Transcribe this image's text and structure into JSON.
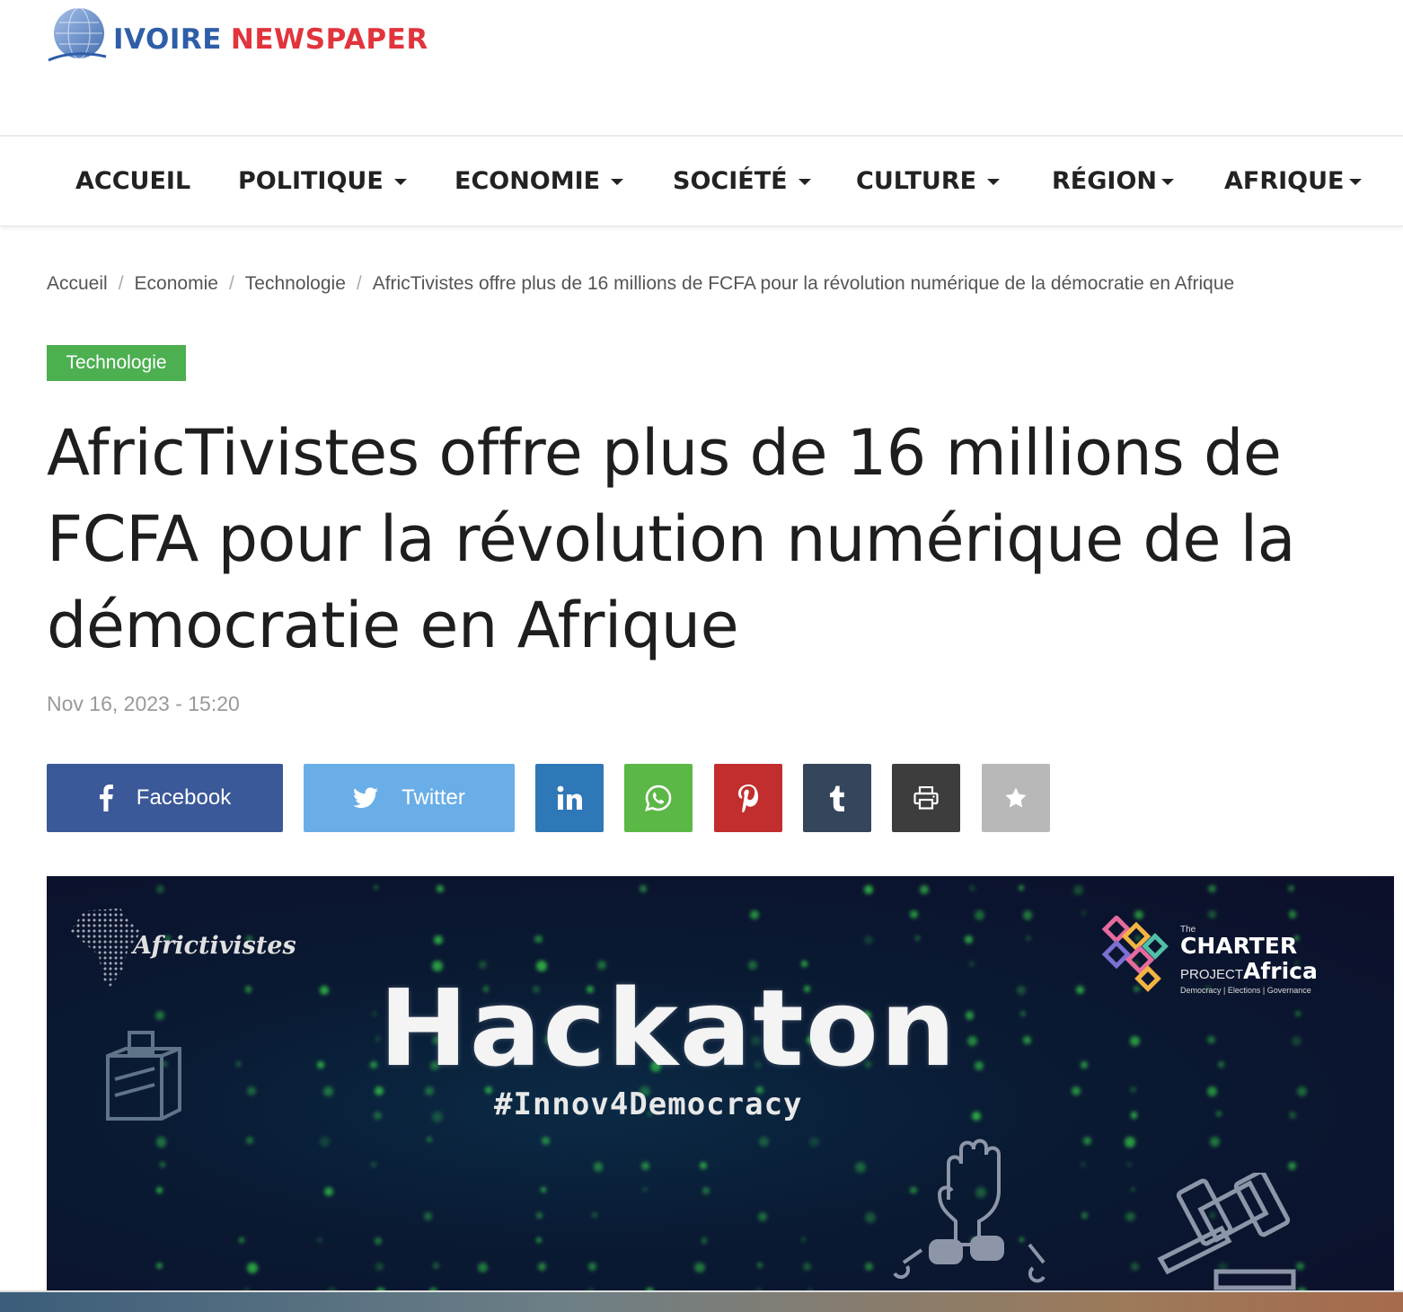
{
  "site": {
    "logo_part1": "IVOIRE",
    "logo_part2": "NEWSPAPER",
    "colors": {
      "logo_blue": "#2f5ea8",
      "logo_red": "#e1343c",
      "category_green": "#4caf50"
    }
  },
  "nav": {
    "items": [
      {
        "label": "ACCUEIL",
        "dropdown": false
      },
      {
        "label": "POLITIQUE",
        "dropdown": true
      },
      {
        "label": "ECONOMIE",
        "dropdown": true
      },
      {
        "label": "SOCIÉTÉ",
        "dropdown": true
      },
      {
        "label": "CULTURE",
        "dropdown": true
      },
      {
        "label": "RÉGION",
        "dropdown": true
      },
      {
        "label": "AFRIQUE",
        "dropdown": true
      }
    ]
  },
  "breadcrumb": {
    "items": [
      "Accueil",
      "Economie",
      "Technologie",
      "AfricTivistes offre plus de 16 millions de FCFA pour la révolution numérique de la démocratie en Afrique"
    ],
    "separator": "/"
  },
  "article": {
    "category": "Technologie",
    "title": "AfricTivistes offre plus de 16 millions de FCFA pour la révolution numérique de la démocratie en Afrique",
    "date": "Nov 16, 2023 - 15:20"
  },
  "share": {
    "facebook": {
      "label": "Facebook",
      "icon": "facebook-icon",
      "color": "#3b5998"
    },
    "twitter": {
      "label": "Twitter",
      "icon": "twitter-icon",
      "color": "#6aaee8"
    },
    "linkedin": {
      "icon": "linkedin-icon",
      "color": "#2f78b7"
    },
    "whatsapp": {
      "icon": "whatsapp-icon",
      "color": "#5bb846"
    },
    "pinterest": {
      "icon": "pinterest-icon",
      "color": "#c22e2e"
    },
    "tumblr": {
      "icon": "tumblr-icon",
      "color": "#35465c"
    },
    "print": {
      "icon": "print-icon",
      "color": "#3d3d3d"
    },
    "favorite": {
      "icon": "star-icon",
      "color": "#b8b8b8"
    }
  },
  "hero": {
    "brand": "Africtivistes",
    "title": "Hackaton",
    "hashtag": "#Innov4Democracy",
    "partner_the": "The",
    "partner_charter": "CHARTER",
    "partner_project": "PROJECT",
    "partner_africa": "Africa",
    "partner_tagline": "Democracy | Elections | Governance"
  }
}
